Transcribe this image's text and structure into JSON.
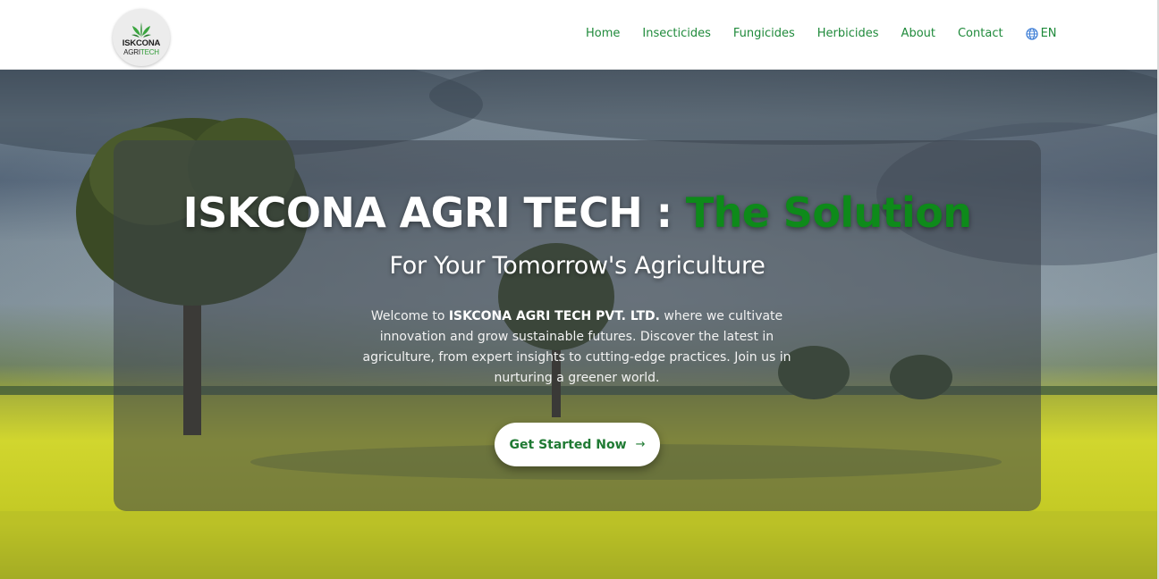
{
  "brand": {
    "logo_word1": "ISKCONA",
    "logo_word2a": "AGRI",
    "logo_word2b": "TECH",
    "accent_color": "#1f8a3b"
  },
  "nav": {
    "items": [
      {
        "label": "Home"
      },
      {
        "label": "Insecticides"
      },
      {
        "label": "Fungicides"
      },
      {
        "label": "Herbicides"
      },
      {
        "label": "About"
      },
      {
        "label": "Contact"
      }
    ],
    "language": {
      "icon": "globe-icon",
      "label": "EN"
    }
  },
  "hero": {
    "title_main": "ISKCONA AGRI TECH : ",
    "title_accent": "The Solution",
    "title_accent_color": "#0e8a1a",
    "subtitle": "For Your Tomorrow's Agriculture",
    "desc_prefix": "Welcome to ",
    "desc_company": "ISKCONA AGRI TECH PVT. LTD.",
    "desc_suffix": " where we cultivate innovation and grow sustainable futures. Discover the latest in agriculture, from expert insights to cutting-edge practices. Join us in nurturing a greener world.",
    "cta_label": "Get Started Now",
    "cta_icon": "→"
  }
}
